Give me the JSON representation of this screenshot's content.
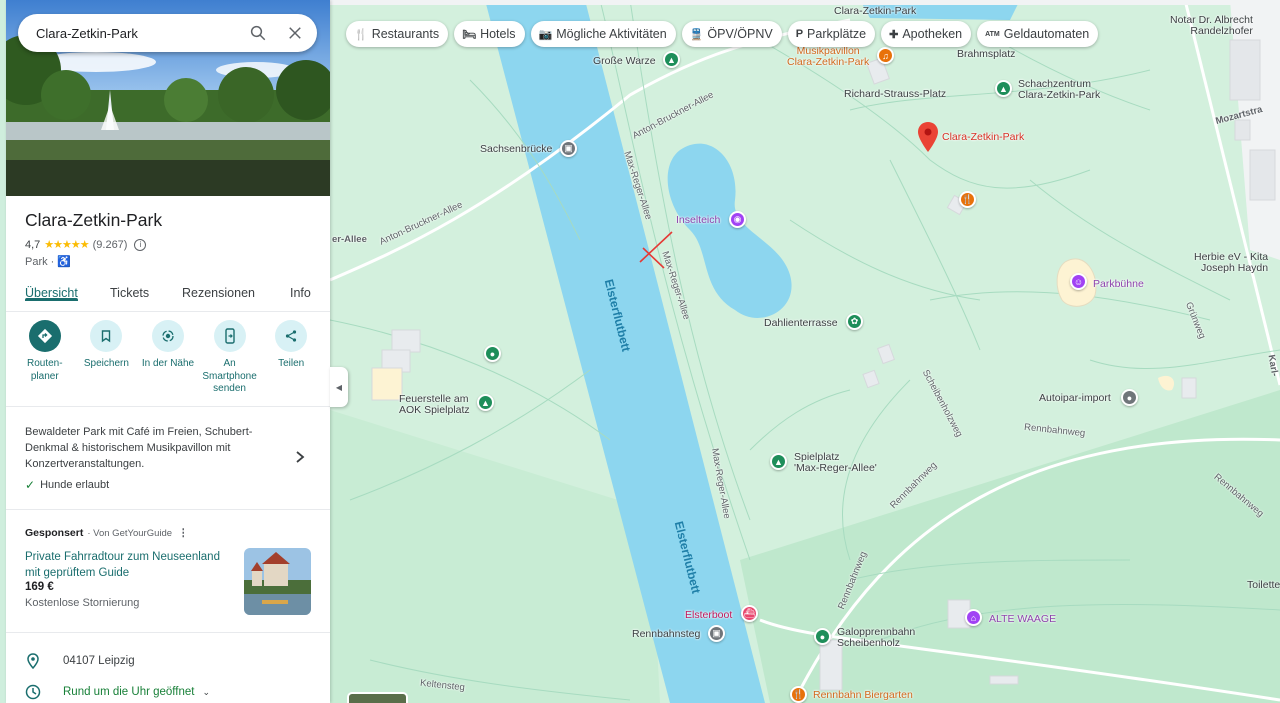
{
  "search": {
    "value": "Clara-Zetkin-Park"
  },
  "place": {
    "title": "Clara-Zetkin-Park",
    "rating": "4,7",
    "stars": "★★★★★",
    "reviews": "(9.267)",
    "category": "Park ·",
    "wheelchair_icon": "wheelchair-icon"
  },
  "tabs": [
    "Übersicht",
    "Tickets",
    "Rezensionen",
    "Info"
  ],
  "actions": [
    {
      "label": "Routen-\nplaner",
      "icon": "directions-icon"
    },
    {
      "label": "Speichern",
      "icon": "bookmark-icon"
    },
    {
      "label": "In der Nähe",
      "icon": "nearby-icon"
    },
    {
      "label": "An\nSmartphone\nsenden",
      "icon": "phone-icon"
    },
    {
      "label": "Teilen",
      "icon": "share-icon"
    }
  ],
  "description": "Bewaldeter Park mit Café im Freien, Schubert-Denkmal & historischem Musikpavillon mit Konzertveranstaltungen.",
  "dogs": "Hunde erlaubt",
  "ad": {
    "sponsored": "Gesponsert",
    "by": "· Von GetYourGuide",
    "title": "Private Fahrradtour zum Neuseenland mit geprüftem Guide",
    "price": "169 €",
    "cancel": "Kostenlose Stornierung"
  },
  "info": {
    "address": "04107 Leipzig",
    "hours": "Rund um die Uhr geöffnet"
  },
  "chips": [
    {
      "label": "Restaurants",
      "icon": "🍴"
    },
    {
      "label": "Hotels",
      "icon": "🛏"
    },
    {
      "label": "Mögliche Aktivitäten",
      "icon": "📷"
    },
    {
      "label": "ÖPV/ÖPNV",
      "icon": "🚆"
    },
    {
      "label": "Parkplätze",
      "icon": "P"
    },
    {
      "label": "Apotheken",
      "icon": "✚"
    },
    {
      "label": "Geldautomaten",
      "icon": "ATM"
    }
  ],
  "map_labels": {
    "clara_park_top": "Clara-Zetkin-Park",
    "musikpavillon": "Musikpavillon\nClara-Zetkin-Park",
    "brahmsplatz": "Brahmsplatz",
    "notar": "Notar Dr. Albrecht\nRandelzhofer",
    "grosse_warze": "Große Warze",
    "schachzentrum": "Schachzentrum\nClara-Zetkin-Park",
    "richard_strauss": "Richard-Strauss-Platz",
    "clara_park_pin": "Clara-Zetkin-Park",
    "mozartstr": "Mozartstra",
    "anton_bruckner_1": "Anton-Bruckner-Allee",
    "anton_bruckner_2": "Anton-Bruckner-Allee",
    "allee_left": "er-Allee",
    "sachsenbruecke": "Sachsenbrücke",
    "max_reger_1": "Max-Reger-Allee",
    "max_reger_2": "Max-Reger-Allee",
    "max_reger_3": "Max-Reger-Allee",
    "inselteich": "Inselteich",
    "elsterflutbett_1": "Elsterflutbett",
    "elsterflutbett_2": "Elsterflutbett",
    "dahlienterrasse": "Dahlienterrasse",
    "parkbuehne": "Parkbühne",
    "herbie": "Herbie eV - Kita\nJoseph Haydn",
    "feuerstelle": "Feuerstelle am\nAOK Spielplatz",
    "schreberweg": "Scheibenholzweg",
    "autoipar": "Autoipar-import",
    "rennbahnweg_1": "Rennbahnweg",
    "rennbahnweg_2": "Rennbahnweg",
    "rennbahnweg_3": "Rennbahnweg",
    "rennbahnweg_4": "Rennbahnweg",
    "spielplatz": "Spielplatz\n'Max-Reger-Allee'",
    "elsterboot": "Elsterboot",
    "rennbahnsteg": "Rennbahnsteg",
    "alte_waage": "ALTE WAAGE",
    "galopp": "Galopprennbahn\nScheibenholz",
    "toilette": "Toilette",
    "keltensteg": "Keltensteg",
    "biergarten": "Rennbahn Biergarten",
    "karl": "Karl-",
    "gruenweg": "Grünweg"
  },
  "colors": {
    "accent": "#1a6e6e",
    "river": "#8dd6ef",
    "park": "#d3f0dd",
    "pin": "#ea4335"
  }
}
